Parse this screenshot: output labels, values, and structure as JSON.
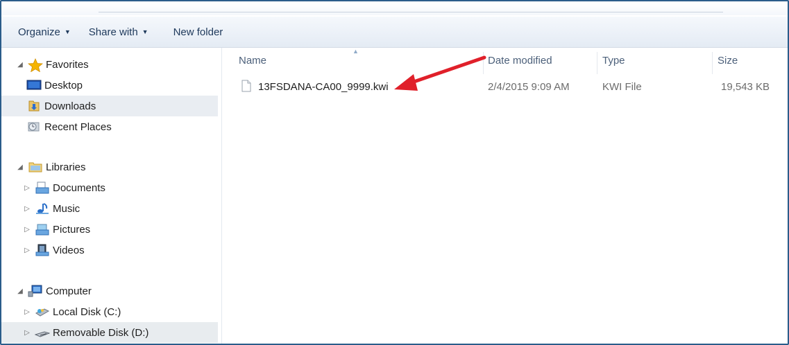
{
  "toolbar": {
    "organize": "Organize",
    "share_with": "Share with",
    "new_folder": "New folder"
  },
  "nav": {
    "favorites": {
      "label": "Favorites",
      "items": [
        {
          "label": "Desktop",
          "icon": "desktop-icon"
        },
        {
          "label": "Downloads",
          "icon": "downloads-folder-icon"
        },
        {
          "label": "Recent Places",
          "icon": "recent-places-icon"
        }
      ]
    },
    "libraries": {
      "label": "Libraries",
      "items": [
        {
          "label": "Documents",
          "icon": "documents-library-icon"
        },
        {
          "label": "Music",
          "icon": "music-library-icon"
        },
        {
          "label": "Pictures",
          "icon": "pictures-library-icon"
        },
        {
          "label": "Videos",
          "icon": "videos-library-icon"
        }
      ]
    },
    "computer": {
      "label": "Computer",
      "items": [
        {
          "label": "Local Disk (C:)",
          "icon": "local-disk-icon"
        },
        {
          "label": "Removable Disk (D:)",
          "icon": "removable-disk-icon"
        }
      ]
    }
  },
  "columns": {
    "name": "Name",
    "date": "Date modified",
    "type": "Type",
    "size": "Size"
  },
  "files": [
    {
      "name": "13FSDANA-CA00_9999.kwi",
      "date": "2/4/2015 9:09 AM",
      "type": "KWI File",
      "size": "19,543 KB"
    }
  ],
  "colors": {
    "frame": "#2a5c8a",
    "annotation_arrow": "#e0202a",
    "selection": "#e9edf2"
  }
}
